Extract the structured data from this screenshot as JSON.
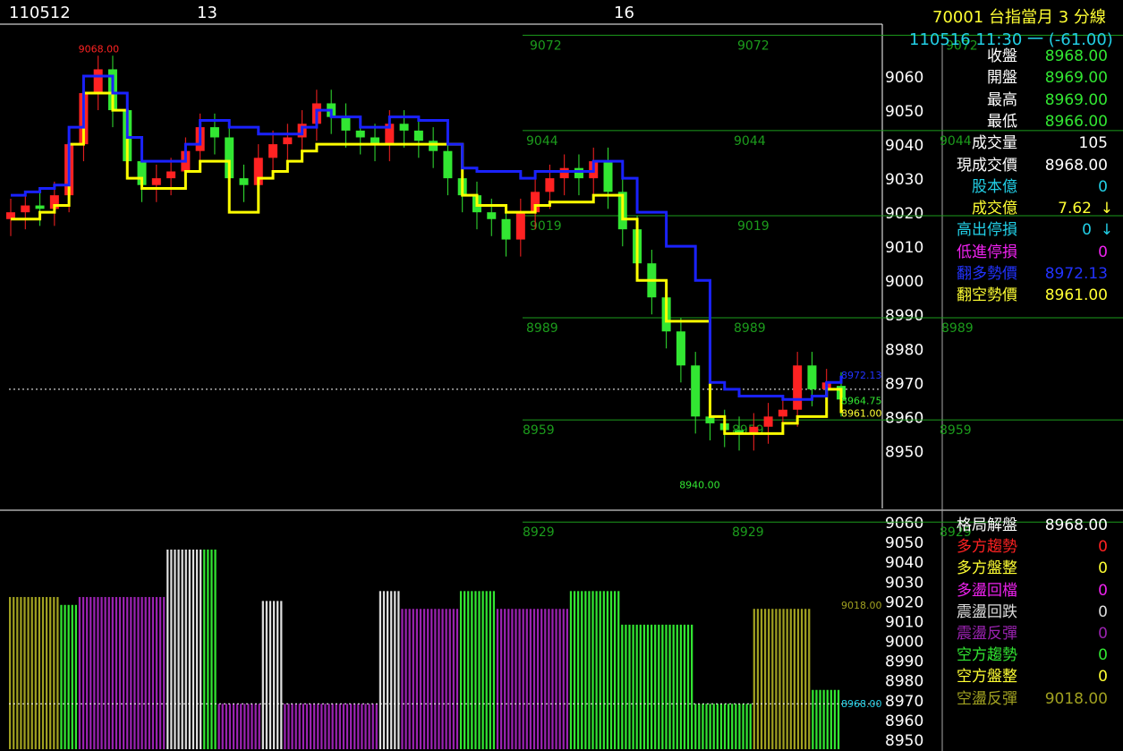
{
  "header": {
    "date_label": "110512",
    "day_13": "13",
    "day_16": "16",
    "symbol_title": "70001  台指當月 3 分線",
    "time_change": "110516 11:30 一  (-61.00)"
  },
  "upper_panel": [
    {
      "label": "收盤",
      "label_color": "#ffffff",
      "value": "8968.00",
      "value_color": "#32e632"
    },
    {
      "label": "開盤",
      "label_color": "#ffffff",
      "value": "8969.00",
      "value_color": "#32e632"
    },
    {
      "label": "最高",
      "label_color": "#ffffff",
      "value": "8969.00",
      "value_color": "#32e632"
    },
    {
      "label": "最低",
      "label_color": "#ffffff",
      "value": "8966.00",
      "value_color": "#32e632"
    },
    {
      "label": "成交量",
      "label_color": "#ffffff",
      "value": "105",
      "value_color": "#ffffff"
    },
    {
      "label": "現成交價",
      "label_color": "#ffffff",
      "value": "8968.00",
      "value_color": "#ffffff"
    },
    {
      "label": "股本億",
      "label_color": "#22cfe6",
      "value": "0",
      "value_color": "#22cfe6"
    },
    {
      "label": "成交億",
      "label_color": "#ffff33",
      "value": "7.62",
      "value_color": "#ffff33",
      "arrow": "↓",
      "arrow_color": "#ffff33"
    },
    {
      "label": "高出停損",
      "label_color": "#22cfe6",
      "value": "0",
      "value_color": "#22cfe6",
      "arrow": "↓",
      "arrow_color": "#22cfe6"
    },
    {
      "label": "低進停損",
      "label_color": "#ee22ee",
      "value": "0",
      "value_color": "#ee22ee"
    },
    {
      "label": "翻多勢價",
      "label_color": "#2233ff",
      "value": "8972.13",
      "value_color": "#2233ff"
    },
    {
      "label": "翻空勢價",
      "label_color": "#ffff33",
      "value": "8961.00",
      "value_color": "#ffff33"
    }
  ],
  "lower_panel": [
    {
      "label": "格局解盤",
      "label_color": "#ffffff",
      "value": "8968.00",
      "value_color": "#ffffff"
    },
    {
      "label": "多方趨勢",
      "label_color": "#ff2222",
      "value": "0",
      "value_color": "#ff2222"
    },
    {
      "label": "多方盤整",
      "label_color": "#ffff33",
      "value": "0",
      "value_color": "#ffff33"
    },
    {
      "label": "多盪回檔",
      "label_color": "#ee22ee",
      "value": "0",
      "value_color": "#ee22ee"
    },
    {
      "label": "震盪回跌",
      "label_color": "#dddddd",
      "value": "0",
      "value_color": "#dddddd"
    },
    {
      "label": "震盪反彈",
      "label_color": "#9a22b0",
      "value": "0",
      "value_color": "#9a22b0"
    },
    {
      "label": "空方趨勢",
      "label_color": "#32e632",
      "value": "0",
      "value_color": "#32e632"
    },
    {
      "label": "空方盤整",
      "label_color": "#ffff33",
      "value": "0",
      "value_color": "#ffff33"
    },
    {
      "label": "空盪反彈",
      "label_color": "#a0a020",
      "value": "9018.00",
      "value_color": "#a0a020"
    }
  ],
  "chart_data": [
    {
      "type": "candlestick",
      "y_ticks": [
        9060,
        9050,
        9040,
        9030,
        9020,
        9010,
        9000,
        8990,
        8980,
        8970,
        8960,
        8950
      ],
      "ylim": [
        8933,
        9075
      ],
      "x_labels": [
        "110512",
        "13",
        "16"
      ],
      "grid_levels": [
        {
          "value": 9072,
          "labels": [
            "9072",
            "9072",
            "9072"
          ]
        },
        {
          "value": 9044,
          "labels": [
            "9044",
            "9044",
            "9044"
          ]
        },
        {
          "value": 9019,
          "labels": [
            "9019",
            "9019"
          ]
        },
        {
          "value": 8989,
          "labels": [
            "8989",
            "8989",
            "8989"
          ]
        },
        {
          "value": 8959,
          "labels": [
            "8959",
            "8959",
            "8959"
          ]
        },
        {
          "value": 8929,
          "labels": [
            "8929",
            "8929",
            "8929"
          ]
        }
      ],
      "annotations": [
        {
          "text": "9068.00",
          "value": 9068,
          "color": "#ff2222"
        },
        {
          "text": "8940.00",
          "value": 8940,
          "color": "#32e632"
        }
      ],
      "right_labels": [
        {
          "text": "8972.13",
          "value": 8972.13,
          "color": "#2233ff"
        },
        {
          "text": "8964.75",
          "value": 8964.75,
          "color": "#32e632"
        },
        {
          "text": "8961.00",
          "value": 8961.0,
          "color": "#ffff33"
        }
      ],
      "blue_line_series": [
        9025,
        9026,
        9027,
        9028,
        9045,
        9060,
        9060,
        9055,
        9042,
        9035,
        9035,
        9035,
        9040,
        9047,
        9047,
        9045,
        9045,
        9043,
        9043,
        9043,
        9045,
        9050,
        9048,
        9048,
        9045,
        9045,
        9048,
        9048,
        9047,
        9047,
        9040,
        9033,
        9032,
        9032,
        9032,
        9030,
        9032,
        9032,
        9032,
        9032,
        9035,
        9035,
        9030,
        9020,
        9020,
        9010,
        9010,
        9000,
        8970,
        8968,
        8966,
        8966,
        8966,
        8965,
        8965,
        8966,
        8970,
        8972
      ],
      "yellow_line_series": [
        9018,
        9018,
        9020,
        9022,
        9040,
        9055,
        9055,
        9050,
        9030,
        9027,
        9027,
        9027,
        9032,
        9035,
        9035,
        9020,
        9020,
        9030,
        9032,
        9035,
        9038,
        9040,
        9040,
        9040,
        9040,
        9040,
        9040,
        9040,
        9040,
        9040,
        9040,
        9025,
        9022,
        9022,
        9020,
        9020,
        9022,
        9023,
        9023,
        9023,
        9025,
        9025,
        9018,
        9000,
        9000,
        8988,
        8988,
        8988,
        8960,
        8955,
        8955,
        8955,
        8955,
        8958,
        8960,
        8960,
        8968,
        8961
      ],
      "closes": [
        9020,
        9022,
        9021,
        9025,
        9040,
        9055,
        9062,
        9050,
        9035,
        9028,
        9030,
        9032,
        9038,
        9045,
        9042,
        9030,
        9028,
        9036,
        9040,
        9042,
        9046,
        9052,
        9048,
        9044,
        9042,
        9040,
        9046,
        9044,
        9041,
        9038,
        9030,
        9025,
        9020,
        9018,
        9012,
        9020,
        9026,
        9030,
        9033,
        9030,
        9035,
        9026,
        9015,
        9005,
        8995,
        8985,
        8975,
        8960,
        8958,
        8956,
        8955,
        8957,
        8960,
        8962,
        8975,
        8968,
        8970,
        8965
      ],
      "opens": [
        9018,
        9020,
        9022,
        9021,
        9025,
        9040,
        9055,
        9062,
        9050,
        9035,
        9028,
        9030,
        9032,
        9038,
        9045,
        9042,
        9030,
        9028,
        9036,
        9040,
        9042,
        9046,
        9052,
        9048,
        9044,
        9042,
        9040,
        9046,
        9044,
        9041,
        9038,
        9030,
        9025,
        9020,
        9018,
        9012,
        9020,
        9026,
        9030,
        9033,
        9030,
        9035,
        9026,
        9015,
        9005,
        8995,
        8985,
        8975,
        8960,
        8958,
        8956,
        8955,
        8957,
        8960,
        8962,
        8975,
        8968,
        8969
      ]
    },
    {
      "type": "bar",
      "y_ticks": [
        9060,
        9050,
        9040,
        9030,
        9020,
        9010,
        9000,
        8990,
        8980,
        8970,
        8960,
        8950
      ],
      "ylim": [
        8945,
        9065
      ],
      "right_labels": [
        {
          "text": "9018.00",
          "value": 9018,
          "color": "#a0a020"
        },
        {
          "text": "8968.00",
          "value": 8968,
          "color": "#22cfe6"
        }
      ],
      "segments": [
        {
          "count": 14,
          "value": 9022,
          "color": "#a0a020"
        },
        {
          "count": 5,
          "value": 9018,
          "color": "#32e632"
        },
        {
          "count": 24,
          "value": 9022,
          "color": "#9a22b0"
        },
        {
          "count": 10,
          "value": 9046,
          "color": "#dddddd"
        },
        {
          "count": 4,
          "value": 9046,
          "color": "#32e632"
        },
        {
          "count": 12,
          "value": 8968,
          "color": "#9a22b0"
        },
        {
          "count": 6,
          "value": 9020,
          "color": "#dddddd"
        },
        {
          "count": 26,
          "value": 8968,
          "color": "#9a22b0"
        },
        {
          "count": 6,
          "value": 9025,
          "color": "#dddddd"
        },
        {
          "count": 16,
          "value": 9016,
          "color": "#9a22b0"
        },
        {
          "count": 10,
          "value": 9025,
          "color": "#32e632"
        },
        {
          "count": 20,
          "value": 9016,
          "color": "#9a22b0"
        },
        {
          "count": 14,
          "value": 9025,
          "color": "#32e632"
        },
        {
          "count": 20,
          "value": 9008,
          "color": "#32e632"
        },
        {
          "count": 16,
          "value": 8968,
          "color": "#32e632"
        },
        {
          "count": 16,
          "value": 9016,
          "color": "#a0a020"
        },
        {
          "count": 8,
          "value": 8975,
          "color": "#32e632"
        }
      ]
    }
  ]
}
